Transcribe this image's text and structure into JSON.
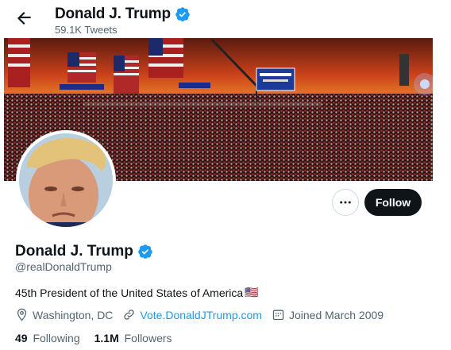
{
  "header": {
    "name": "Donald J. Trump",
    "tweet_count": "59.1K Tweets",
    "back_icon": "arrow-left-icon"
  },
  "banner": {
    "signs": [
      "MAKE AMERICA GREAT AGAIN!",
      "MAKE AMERICA GREAT AGAIN!",
      "PENNSYLVANIA"
    ]
  },
  "actions": {
    "more_icon": "more-dots-icon",
    "follow_label": "Follow"
  },
  "profile": {
    "name": "Donald J. Trump",
    "handle": "@realDonaldTrump",
    "bio": "45th President of the United States of America",
    "bio_flag": "🇺🇸",
    "location": "Washington, DC",
    "website": "Vote.DonaldJTrump.com",
    "joined": "Joined March 2009"
  },
  "stats": {
    "following_count": "49",
    "following_label": "Following",
    "followers_count": "1.1M",
    "followers_label": "Followers"
  },
  "colors": {
    "accent": "#1d9bf0",
    "text": "#0f1419",
    "muted": "#536471",
    "follow_bg": "#0f1419"
  }
}
